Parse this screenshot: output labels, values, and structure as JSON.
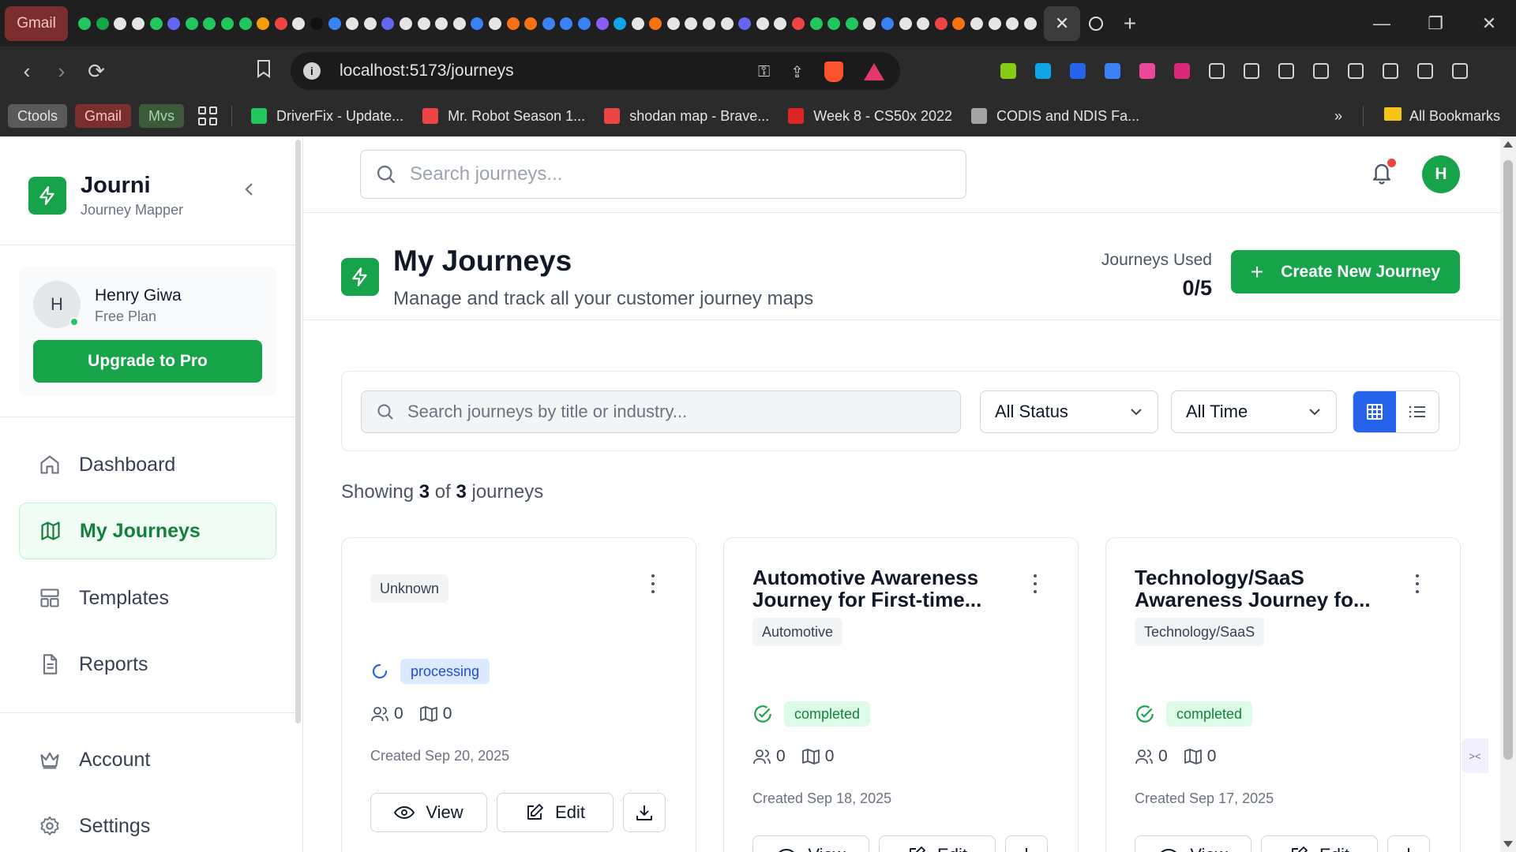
{
  "browser": {
    "pinned_tab_label": "Gmail",
    "pinned_colors": [
      "#22c55e",
      "#16a34a",
      "#e5e5e5",
      "#e5e5e5",
      "#22c55e",
      "#6366f1",
      "#22c55e",
      "#22c55e",
      "#22c55e",
      "#22c55e",
      "#f59e0b",
      "#ef4444",
      "#e5e5e5",
      "#111",
      "#3b82f6",
      "#e5e5e5",
      "#e5e5e5",
      "#6366f1",
      "#e5e5e5",
      "#e5e5e5",
      "#e5e5e5",
      "#e5e5e5",
      "#3b82f6",
      "#e5e5e5",
      "#f97316",
      "#f97316",
      "#3b82f6",
      "#3b82f6",
      "#3b82f6",
      "#8b5cf6",
      "#0ea5e9",
      "#e5e5e5",
      "#f97316",
      "#e5e5e5",
      "#e5e5e5",
      "#e5e5e5",
      "#e5e5e5",
      "#6366f1",
      "#e5e5e5",
      "#e5e5e5",
      "#ef4444",
      "#22c55e",
      "#22c55e",
      "#22c55e",
      "#e5e5e5",
      "#3b82f6",
      "#e5e5e5",
      "#e5e5e5",
      "#ef4444",
      "#f97316",
      "#e5e5e5",
      "#e5e5e5",
      "#e5e5e5",
      "#e5e5e5"
    ],
    "url": "localhost:5173/journeys",
    "bookmark_chips": [
      {
        "label": "Ctools",
        "bg": "#5a5a5a",
        "fg": "#e5e5e5"
      },
      {
        "label": "Gmail",
        "bg": "#7a2e2e",
        "fg": "#f8c4c4"
      },
      {
        "label": "Mvs",
        "bg": "#3d5a3d",
        "fg": "#a7d7a7"
      }
    ],
    "bookmarks": [
      {
        "label": "DriverFix - Update...",
        "color": "#22c55e"
      },
      {
        "label": "Mr. Robot Season 1...",
        "color": "#ef4444"
      },
      {
        "label": "shodan map - Brave...",
        "color": "#ef4444"
      },
      {
        "label": "Week 8 - CS50x 2022",
        "color": "#dc2626"
      },
      {
        "label": "CODIS and NDIS Fa...",
        "color": "#a3a3a3"
      }
    ],
    "all_bookmarks": "All Bookmarks"
  },
  "sidebar": {
    "brand_name": "Journi",
    "brand_sub": "Journey Mapper",
    "user": {
      "initial": "H",
      "name": "Henry Giwa",
      "plan": "Free Plan"
    },
    "upgrade_label": "Upgrade to Pro",
    "nav": [
      {
        "label": "Dashboard",
        "icon": "home-icon"
      },
      {
        "label": "My Journeys",
        "icon": "map-icon",
        "active": true
      },
      {
        "label": "Templates",
        "icon": "templates-icon"
      },
      {
        "label": "Reports",
        "icon": "document-icon"
      },
      {
        "label": "Account",
        "icon": "crown-icon"
      },
      {
        "label": "Settings",
        "icon": "gear-icon"
      }
    ]
  },
  "topbar": {
    "search_placeholder": "Search journeys...",
    "avatar_initial": "H"
  },
  "header": {
    "title": "My Journeys",
    "subtitle": "Manage and track all your customer journey maps",
    "used_label": "Journeys Used",
    "used_value": "0/5",
    "create_label": "Create New Journey"
  },
  "filters": {
    "search_placeholder": "Search journeys by title or industry...",
    "status_value": "All Status",
    "time_value": "All Time"
  },
  "showing": {
    "prefix": "Showing",
    "count": "3",
    "of": "of",
    "total": "3",
    "suffix": "journeys"
  },
  "cards": [
    {
      "title_line1": "",
      "title_line2": "",
      "tag": "Unknown",
      "status": "processing",
      "users": "0",
      "maps": "0",
      "created": "Created Sep 20, 2025",
      "view_label": "View",
      "edit_label": "Edit"
    },
    {
      "title_line1": "Automotive Awareness",
      "title_line2": "Journey for First-time...",
      "tag": "Automotive",
      "status": "completed",
      "users": "0",
      "maps": "0",
      "created": "Created Sep 18, 2025",
      "view_label": "View",
      "edit_label": "Edit"
    },
    {
      "title_line1": "Technology/SaaS",
      "title_line2": "Awareness Journey fo...",
      "tag": "Technology/SaaS",
      "status": "completed",
      "users": "0",
      "maps": "0",
      "created": "Created Sep 17, 2025",
      "view_label": "View",
      "edit_label": "Edit"
    }
  ],
  "side_tab_glyph": "><",
  "colors": {
    "brand": "#16a34a",
    "active_view": "#2563eb",
    "processing": "#1d4ed8",
    "completed": "#15803d"
  }
}
